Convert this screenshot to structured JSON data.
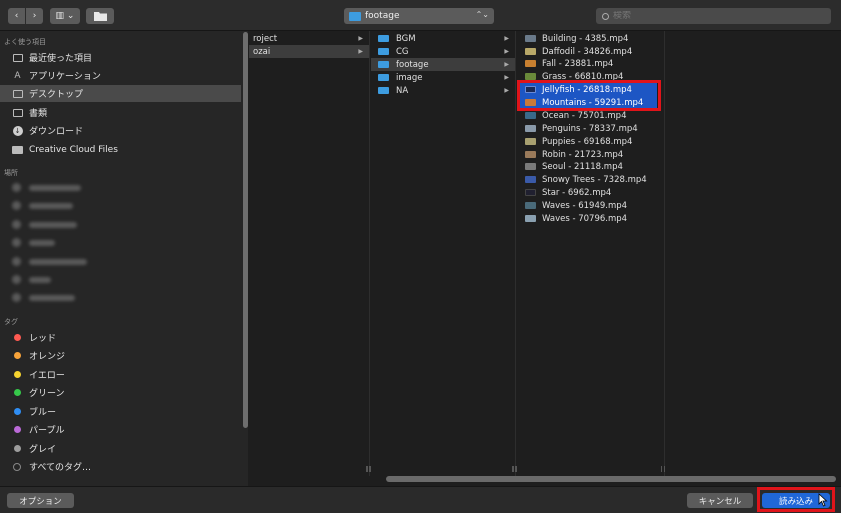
{
  "toolbar": {
    "back": "‹",
    "forward": "›",
    "view": "▥ ⌄",
    "path": "footage",
    "search_placeholder": "検索"
  },
  "sidebar": {
    "favorites_header": "よく使う項目",
    "favorites": [
      {
        "label": "最近使った項目",
        "icon": "recent-icon"
      },
      {
        "label": "アプリケーション",
        "icon": "applications-icon"
      },
      {
        "label": "デスクトップ",
        "icon": "desktop-icon",
        "selected": true
      },
      {
        "label": "書類",
        "icon": "documents-icon"
      },
      {
        "label": "ダウンロード",
        "icon": "downloads-icon"
      },
      {
        "label": "Creative Cloud Files",
        "icon": "folder-icon"
      }
    ],
    "locations_header": "場所",
    "locations_count": 6,
    "tags_header": "タグ",
    "tags": [
      {
        "label": "レッド",
        "color": "#ff5a52"
      },
      {
        "label": "オレンジ",
        "color": "#f7a33a"
      },
      {
        "label": "イエロー",
        "color": "#f5d32f"
      },
      {
        "label": "グリーン",
        "color": "#36c84a"
      },
      {
        "label": "ブルー",
        "color": "#2f8ef4"
      },
      {
        "label": "パープル",
        "color": "#bb6ad8"
      },
      {
        "label": "グレイ",
        "color": "#9d9d9d"
      }
    ],
    "all_tags": "すべてのタグ…"
  },
  "columns": {
    "col1": [
      "roject",
      "ozai"
    ],
    "col2": [
      "BGM",
      "CG",
      "footage",
      "image",
      "NA"
    ],
    "col3": [
      {
        "name": "Building - 4385.mp4",
        "thumb": "#6a7a8a"
      },
      {
        "name": "Daffodil - 34826.mp4",
        "thumb": "#b8a868"
      },
      {
        "name": "Fall - 23881.mp4",
        "thumb": "#c88030"
      },
      {
        "name": "Grass - 66810.mp4",
        "thumb": "#6a8a3a"
      },
      {
        "name": "Jellyfish - 26818.mp4",
        "thumb": "#1a2a5a",
        "highlight": true
      },
      {
        "name": "Mountains - 59291.mp4",
        "thumb": "#c87a3a",
        "highlight": true
      },
      {
        "name": "Ocean - 75701.mp4",
        "thumb": "#3a6a8a"
      },
      {
        "name": "Penguins - 78337.mp4",
        "thumb": "#8a9aaa"
      },
      {
        "name": "Puppies - 69168.mp4",
        "thumb": "#a8a070"
      },
      {
        "name": "Robin - 21723.mp4",
        "thumb": "#9a7a5a"
      },
      {
        "name": "Seoul - 21118.mp4",
        "thumb": "#7a7a7a"
      },
      {
        "name": "Snowy Trees - 7328.mp4",
        "thumb": "#3a5aa8"
      },
      {
        "name": "Star - 6962.mp4",
        "thumb": "#202030"
      },
      {
        "name": "Waves - 61949.mp4",
        "thumb": "#4a6a7a"
      },
      {
        "name": "Waves - 70796.mp4",
        "thumb": "#8aa0b0"
      }
    ]
  },
  "footer": {
    "options": "オプション",
    "cancel": "キャンセル",
    "import": "読み込み"
  },
  "colors": {
    "accent": "#2067d8",
    "highlight_box": "#e0141a",
    "folder": "#3d9ce0"
  }
}
